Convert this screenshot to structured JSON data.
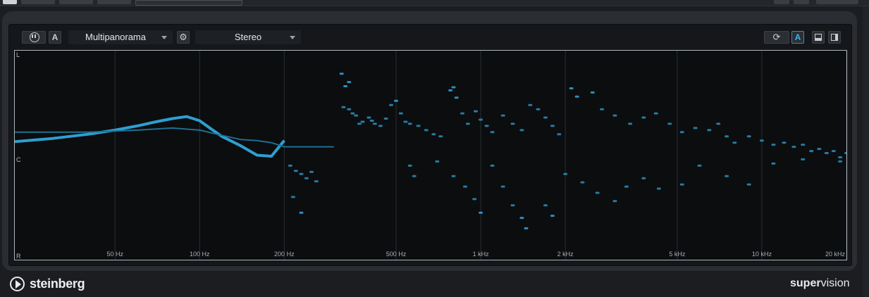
{
  "toolbar": {
    "module_select": "Multipanorama",
    "channel_select": "Stereo",
    "a_label": "A",
    "a2_label": "A"
  },
  "icons": {
    "pause": "pause-icon",
    "settings": "gear-icon",
    "refresh": "refresh-icon",
    "layout_bottom": "layout-bottom-icon",
    "layout_right": "layout-right-icon"
  },
  "channel_labels": {
    "top": "L",
    "center": "C",
    "bottom": "R"
  },
  "chart_data": {
    "type": "scatter",
    "title": "",
    "xscale": "log",
    "xlim": [
      22,
      20000
    ],
    "ylim": [
      -1,
      1
    ],
    "x_ticks": [
      {
        "value": 50,
        "label": "50 Hz"
      },
      {
        "value": 100,
        "label": "100 Hz"
      },
      {
        "value": 200,
        "label": "200 Hz"
      },
      {
        "value": 500,
        "label": "500 Hz"
      },
      {
        "value": 1000,
        "label": "1 kHz"
      },
      {
        "value": 2000,
        "label": "2 kHz"
      },
      {
        "value": 5000,
        "label": "5 kHz"
      },
      {
        "value": 10000,
        "label": "10 kHz"
      },
      {
        "value": 20000,
        "label": "20 kHz"
      }
    ],
    "grid": true,
    "series": [
      {
        "color": "#2f9fd0",
        "x": [
          22,
          30,
          40,
          50,
          60,
          70,
          80,
          90,
          100,
          110,
          120,
          140,
          160,
          180,
          200
        ],
        "y": [
          0.13,
          0.16,
          0.2,
          0.24,
          0.28,
          0.32,
          0.35,
          0.37,
          0.33,
          0.25,
          0.18,
          0.09,
          0.0,
          -0.01,
          0.14
        ]
      },
      {
        "color": "#1f6f92",
        "x": [
          22,
          40,
          60,
          80,
          100,
          120,
          140,
          160,
          180,
          200,
          250,
          300
        ],
        "y": [
          0.22,
          0.22,
          0.24,
          0.26,
          0.24,
          0.19,
          0.15,
          0.14,
          0.12,
          0.08,
          0.08,
          0.08
        ]
      }
    ],
    "points": [
      [
        320,
        0.78
      ],
      [
        330,
        0.66
      ],
      [
        340,
        0.7
      ],
      [
        325,
        0.46
      ],
      [
        340,
        0.44
      ],
      [
        350,
        0.4
      ],
      [
        360,
        0.38
      ],
      [
        370,
        0.3
      ],
      [
        380,
        0.32
      ],
      [
        400,
        0.36
      ],
      [
        410,
        0.33
      ],
      [
        420,
        0.3
      ],
      [
        440,
        0.28
      ],
      [
        460,
        0.35
      ],
      [
        480,
        0.48
      ],
      [
        500,
        0.52
      ],
      [
        520,
        0.4
      ],
      [
        540,
        0.32
      ],
      [
        560,
        0.3
      ],
      [
        600,
        0.28
      ],
      [
        640,
        0.24
      ],
      [
        680,
        0.2
      ],
      [
        720,
        0.18
      ],
      [
        780,
        0.62
      ],
      [
        800,
        0.65
      ],
      [
        820,
        0.55
      ],
      [
        860,
        0.4
      ],
      [
        900,
        0.3
      ],
      [
        960,
        0.42
      ],
      [
        1000,
        0.34
      ],
      [
        1050,
        0.28
      ],
      [
        1100,
        0.22
      ],
      [
        1200,
        0.38
      ],
      [
        1300,
        0.3
      ],
      [
        1400,
        0.24
      ],
      [
        1500,
        0.48
      ],
      [
        1600,
        0.44
      ],
      [
        1700,
        0.36
      ],
      [
        1800,
        0.28
      ],
      [
        1900,
        0.2
      ],
      [
        2100,
        0.64
      ],
      [
        2200,
        0.56
      ],
      [
        2500,
        0.6
      ],
      [
        2700,
        0.44
      ],
      [
        3000,
        0.38
      ],
      [
        3400,
        0.3
      ],
      [
        3800,
        0.36
      ],
      [
        4200,
        0.4
      ],
      [
        4700,
        0.3
      ],
      [
        5200,
        0.22
      ],
      [
        5800,
        0.26
      ],
      [
        6500,
        0.24
      ],
      [
        7000,
        0.3
      ],
      [
        7500,
        0.18
      ],
      [
        8000,
        0.12
      ],
      [
        9000,
        0.18
      ],
      [
        10000,
        0.14
      ],
      [
        11000,
        0.1
      ],
      [
        12000,
        0.12
      ],
      [
        13000,
        0.08
      ],
      [
        14000,
        0.1
      ],
      [
        15000,
        0.04
      ],
      [
        16000,
        0.06
      ],
      [
        17000,
        0.02
      ],
      [
        18000,
        0.04
      ],
      [
        19000,
        -0.02
      ],
      [
        20000,
        0.02
      ],
      [
        210,
        -0.1
      ],
      [
        220,
        -0.15
      ],
      [
        230,
        -0.18
      ],
      [
        240,
        -0.22
      ],
      [
        250,
        -0.16
      ],
      [
        260,
        -0.25
      ],
      [
        215,
        -0.4
      ],
      [
        230,
        -0.55
      ],
      [
        560,
        -0.1
      ],
      [
        580,
        -0.2
      ],
      [
        700,
        -0.06
      ],
      [
        800,
        -0.2
      ],
      [
        880,
        -0.3
      ],
      [
        950,
        -0.42
      ],
      [
        1000,
        -0.55
      ],
      [
        1100,
        -0.1
      ],
      [
        1200,
        -0.3
      ],
      [
        1300,
        -0.48
      ],
      [
        1400,
        -0.6
      ],
      [
        1450,
        -0.7
      ],
      [
        1700,
        -0.48
      ],
      [
        1800,
        -0.58
      ],
      [
        2000,
        -0.18
      ],
      [
        2300,
        -0.26
      ],
      [
        2600,
        -0.36
      ],
      [
        3000,
        -0.44
      ],
      [
        3300,
        -0.3
      ],
      [
        3800,
        -0.22
      ],
      [
        4300,
        -0.32
      ],
      [
        5200,
        -0.28
      ],
      [
        6000,
        -0.1
      ],
      [
        7500,
        -0.2
      ],
      [
        9000,
        -0.28
      ],
      [
        11000,
        -0.08
      ],
      [
        14000,
        -0.04
      ],
      [
        19000,
        -0.06
      ]
    ]
  },
  "brand": {
    "left": "steinberg",
    "right_bold": "super",
    "right_light": "vision"
  }
}
